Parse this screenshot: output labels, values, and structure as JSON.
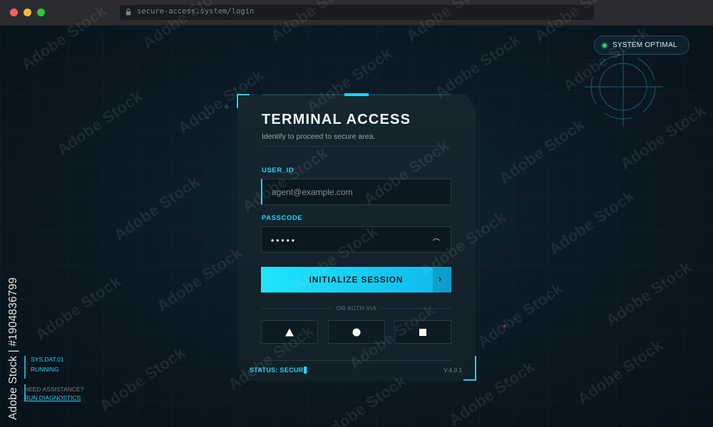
{
  "browser": {
    "url": "secure-access.system/login"
  },
  "status_pill": {
    "label": "SYSTEM OPTIMAL",
    "dot_color": "#28d46a"
  },
  "card": {
    "title": "TERMINAL ACCESS",
    "subtitle": "Identify to proceed to secure area.",
    "user_field": {
      "label": "USER_ID",
      "placeholder": "agent@example.com"
    },
    "pass_field": {
      "label": "PASSCODE",
      "value_mask": "•••••",
      "toggle_icon": "eye-icon"
    },
    "submit_label": "INITIALIZE SESSION",
    "submit_arrow": "›",
    "divider_text": "OR AUTH VIA",
    "auth_options": [
      {
        "icon": "triangle-icon"
      },
      {
        "icon": "circle-icon"
      },
      {
        "icon": "square-icon"
      }
    ],
    "status_text": "STATUS: SECURE",
    "version": "V.4.0.1"
  },
  "side_panel": {
    "sys_code": "SYS.DAT.01",
    "sys_state": "RUNNING",
    "help_prompt": "NEED ASSISTANCE?",
    "help_link": "RUN DIAGNOSTICS"
  },
  "watermark": {
    "text": "Adobe Stock",
    "id_text": "Adobe Stock | #1904836799"
  },
  "colors": {
    "accent": "#26d3f0",
    "background": "#0a1620",
    "card": "#15262f"
  }
}
